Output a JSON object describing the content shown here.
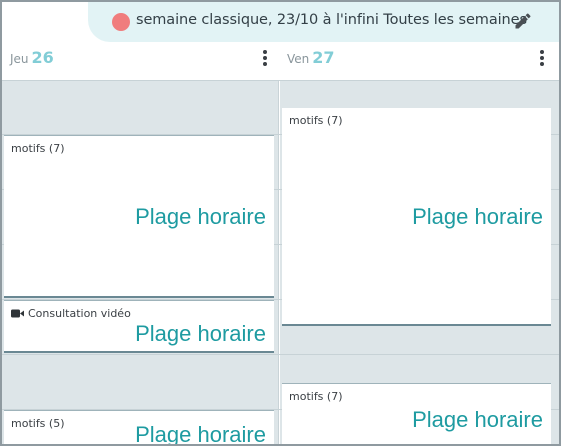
{
  "banner": {
    "color": "#f07d7d",
    "text": "semaine classique, 23/10 à l'infini Toutes les semaines",
    "edit_icon": "pencil-icon"
  },
  "days": [
    {
      "weekday": "Jeu",
      "day": "26",
      "menu_icon": "kebab-menu-icon"
    },
    {
      "weekday": "Ven",
      "day": "27",
      "menu_icon": "kebab-menu-icon"
    }
  ],
  "slots": {
    "thu_1": {
      "label": "motifs (7)",
      "title": "Plage horaire"
    },
    "thu_2": {
      "label": "Consultation vidéo",
      "title": "Plage horaire",
      "icon": "video-camera-icon"
    },
    "thu_3": {
      "label": "motifs (5)",
      "title": "Plage horaire"
    },
    "fri_1": {
      "label": "motifs (7)",
      "title": "Plage horaire"
    },
    "fri_2": {
      "label": "motifs (7)",
      "title": "Plage horaire"
    }
  }
}
